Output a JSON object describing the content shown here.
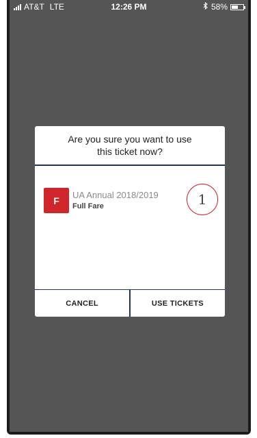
{
  "status_bar": {
    "carrier": "AT&T",
    "network": "LTE",
    "time": "12:26 PM",
    "bluetooth_icon": "bluetooth-icon",
    "battery_percent": "58%",
    "battery_level": 0.58
  },
  "dialog": {
    "title": "Are you sure you want to use this ticket now?",
    "ticket": {
      "badge_letter": "F",
      "name": "UA Annual 2018/2019",
      "type": "Full Fare",
      "quantity": "1"
    },
    "cancel_label": "CANCEL",
    "confirm_label": "USE TICKETS"
  },
  "colors": {
    "accent_red": "#d0252b",
    "divider_navy": "#23345a",
    "overlay_gray": "#555555"
  }
}
